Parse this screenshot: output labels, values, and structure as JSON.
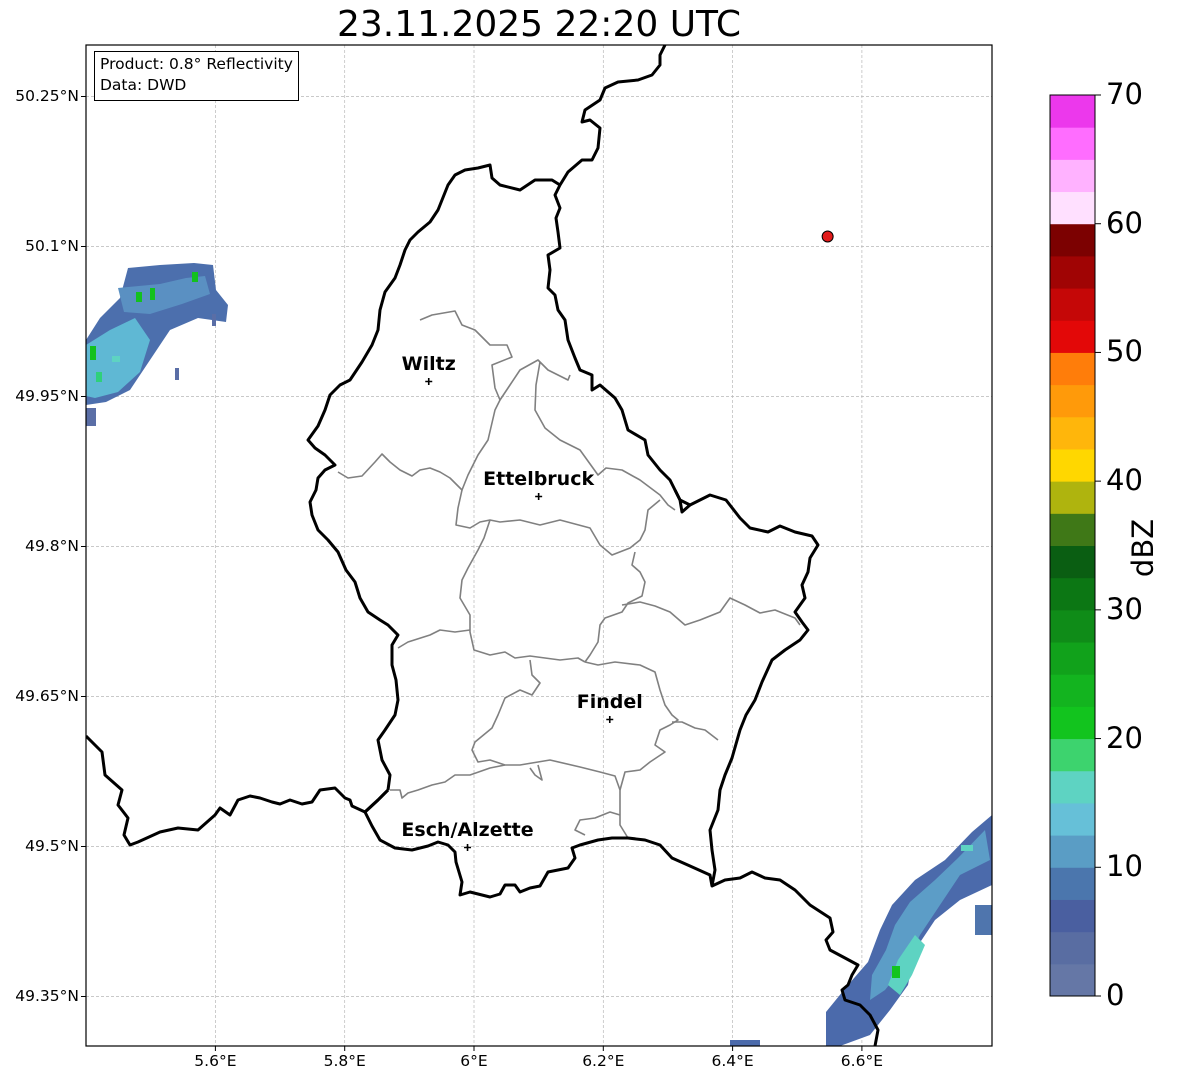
{
  "title": "23.11.2025 22:20 UTC",
  "info": {
    "product": "Product: 0.8° Reflectivity",
    "source": "Data: DWD"
  },
  "axes": {
    "lat_ticks": [
      {
        "value": 50.25,
        "label": "50.25°N"
      },
      {
        "value": 50.1,
        "label": "50.1°N"
      },
      {
        "value": 49.95,
        "label": "49.95°N"
      },
      {
        "value": 49.8,
        "label": "49.8°N"
      },
      {
        "value": 49.65,
        "label": "49.65°N"
      },
      {
        "value": 49.5,
        "label": "49.5°N"
      },
      {
        "value": 49.35,
        "label": "49.35°N"
      }
    ],
    "lon_ticks": [
      {
        "value": 5.6,
        "label": "5.6°E"
      },
      {
        "value": 5.8,
        "label": "5.8°E"
      },
      {
        "value": 6.0,
        "label": "6°E"
      },
      {
        "value": 6.2,
        "label": "6.2°E"
      },
      {
        "value": 6.4,
        "label": "6.4°E"
      },
      {
        "value": 6.6,
        "label": "6.6°E"
      }
    ],
    "lon_range": [
      5.4,
      6.8
    ],
    "lat_range": [
      49.3,
      50.3
    ]
  },
  "cities": [
    {
      "name": "Wiltz",
      "lon": 5.93,
      "lat": 49.965
    },
    {
      "name": "Ettelbruck",
      "lon": 6.1,
      "lat": 49.85
    },
    {
      "name": "Findel",
      "lon": 6.21,
      "lat": 49.627
    },
    {
      "name": "Esch/Alzette",
      "lon": 5.99,
      "lat": 49.499
    }
  ],
  "radar_site": {
    "lon": 6.547,
    "lat": 50.11,
    "color": "#e11a1a"
  },
  "colorbar": {
    "label": "dBZ",
    "min": 0,
    "max": 70,
    "ticks": [
      "0",
      "10",
      "20",
      "30",
      "40",
      "50",
      "60",
      "70"
    ],
    "colors": [
      "#6577a6",
      "#596da2",
      "#4a5fa0",
      "#4b76ad",
      "#5a9dc5",
      "#66c0d8",
      "#5ed3c2",
      "#3dd36e",
      "#12c41e",
      "#13b41f",
      "#11a21b",
      "#0f8c18",
      "#0c7714",
      "#0a5e12",
      "#3f7817",
      "#afb40e",
      "#ffd700",
      "#ffb60b",
      "#ff9a0a",
      "#ff7d0a",
      "#e30808",
      "#c50707",
      "#a00404",
      "#7c0101",
      "#ffe0ff",
      "#ffb2ff",
      "#ff6dff",
      "#ec38ec"
    ]
  }
}
